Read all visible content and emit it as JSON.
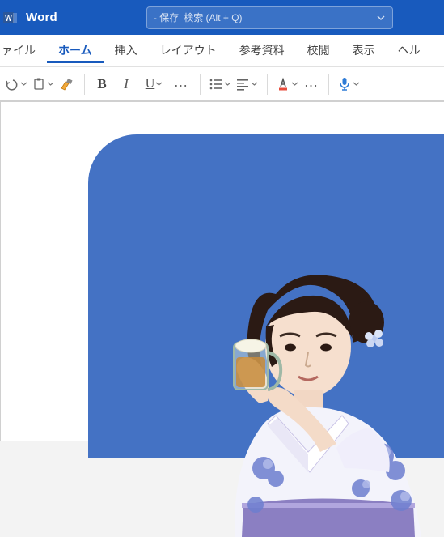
{
  "app": {
    "title": "Word"
  },
  "search": {
    "save_prefix": "‐ 保存",
    "placeholder": "検索 (Alt + Q)"
  },
  "tabs": {
    "file_partial": "ァイル",
    "home": "ホーム",
    "insert": "挿入",
    "layout": "レイアウト",
    "references": "参考資料",
    "review": "校閲",
    "view": "表示",
    "help_partial": "ヘル"
  },
  "toolbar": {
    "bold": "B",
    "italic": "I",
    "underline": "U",
    "more": "…"
  }
}
